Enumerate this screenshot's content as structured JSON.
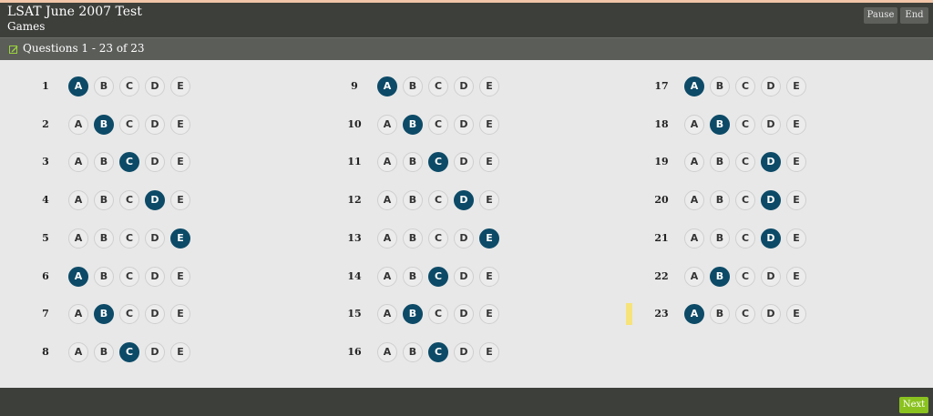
{
  "header": {
    "title": "LSAT June 2007 Test",
    "subtitle": "Games",
    "pause_label": "Pause",
    "end_label": "End"
  },
  "subbar": {
    "icon": "edit-icon",
    "label": "Questions 1 - 23 of 23"
  },
  "choices": [
    "A",
    "B",
    "C",
    "D",
    "E"
  ],
  "questions": [
    {
      "num": "1",
      "selected": "A"
    },
    {
      "num": "2",
      "selected": "B"
    },
    {
      "num": "3",
      "selected": "C"
    },
    {
      "num": "4",
      "selected": "D"
    },
    {
      "num": "5",
      "selected": "E"
    },
    {
      "num": "6",
      "selected": "A"
    },
    {
      "num": "7",
      "selected": "B"
    },
    {
      "num": "8",
      "selected": "C"
    },
    {
      "num": "9",
      "selected": "A"
    },
    {
      "num": "10",
      "selected": "B"
    },
    {
      "num": "11",
      "selected": "C"
    },
    {
      "num": "12",
      "selected": "D"
    },
    {
      "num": "13",
      "selected": "E"
    },
    {
      "num": "14",
      "selected": "C"
    },
    {
      "num": "15",
      "selected": "B"
    },
    {
      "num": "16",
      "selected": "C"
    },
    {
      "num": "17",
      "selected": "A"
    },
    {
      "num": "18",
      "selected": "B"
    },
    {
      "num": "19",
      "selected": "D"
    },
    {
      "num": "20",
      "selected": "D"
    },
    {
      "num": "21",
      "selected": "D"
    },
    {
      "num": "22",
      "selected": "B"
    },
    {
      "num": "23",
      "selected": "A",
      "flagged": true
    }
  ],
  "colors": {
    "selected": "#0c4a67",
    "flag": "#f6e37a",
    "next": "#8ac21f"
  },
  "footer": {
    "next_label": "Next"
  }
}
